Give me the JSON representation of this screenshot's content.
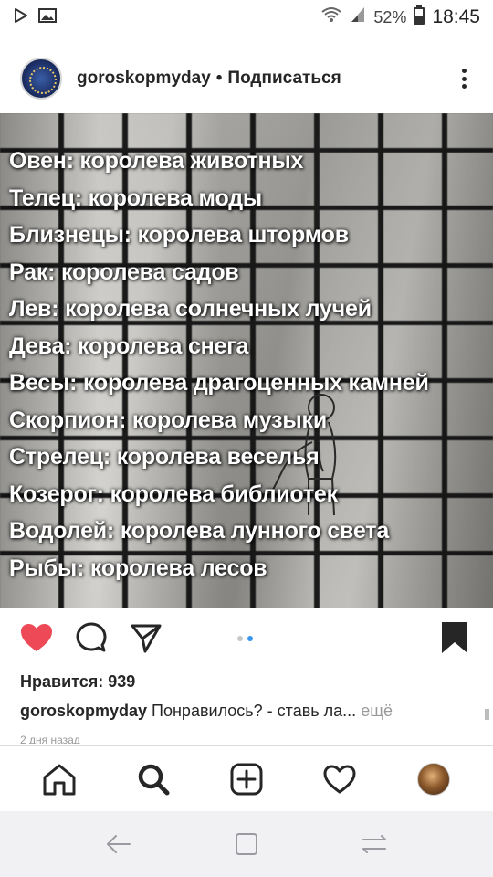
{
  "status_bar": {
    "battery_percent": "52%",
    "time": "18:45",
    "icons": [
      "play-store-icon",
      "image-icon",
      "wifi-icon",
      "signal-icon",
      "battery-icon"
    ]
  },
  "post": {
    "username": "goroskopmyday",
    "separator": "•",
    "follow_label": "Подписаться",
    "image_text_lines": [
      "Овен: королева животных",
      "Телец: королева моды",
      "Близнецы: королева штормов",
      "Рак: королева садов",
      "Лев: королева солнечных лучей",
      "Дева: королева снега",
      "Весы: королева драгоценных камней",
      "Скорпион: королева музыки",
      "Стрелец: королева веселья",
      "Козерог: королева библиотек",
      "Водолей: королева лунного света",
      "Рыбы: королева лесов"
    ],
    "likes_label": "Нравится: 939",
    "caption_user": "goroskopmyday",
    "caption_text": " Понравилось? - ставь ла...",
    "caption_more": " ещё",
    "timestamp": "2 дня назад",
    "carousel": {
      "total": 2,
      "active": 2
    }
  },
  "colors": {
    "like_red": "#ed4956",
    "dot_blue": "#3897f0",
    "text": "#262626"
  },
  "bottom_nav": {
    "items": [
      "home-icon",
      "search-icon",
      "new-post-icon",
      "activity-heart-icon",
      "profile-avatar"
    ]
  },
  "android_nav": {
    "items": [
      "back-icon",
      "recents-icon",
      "menu-icon"
    ]
  }
}
